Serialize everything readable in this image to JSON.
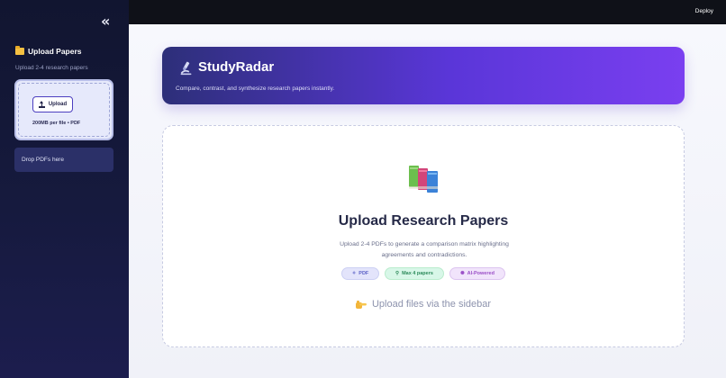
{
  "sidebar": {
    "collapse_icon": "«",
    "title": "Upload Papers",
    "folder_icon": "folder-icon",
    "subtitle": "Upload 2-4 research papers",
    "upload_button": "Upload",
    "limit_text": "200MB per file • PDF",
    "drop_text": "Drop PDFs here"
  },
  "topbar": {
    "deploy_label": "Deploy"
  },
  "hero": {
    "title": "StudyRadar",
    "subtitle": "Compare, contrast, and synthesize research papers instantly.",
    "icon": "microscope-icon"
  },
  "card": {
    "title": "Upload Research Papers",
    "description": "Upload 2-4 PDFs to generate a comparison matrix highlighting agreements and contradictions.",
    "chips": [
      {
        "label": "PDF",
        "icon": "sparkle-icon",
        "color": "#5d62c7"
      },
      {
        "label": "Max 4 papers",
        "icon": "magnifier-icon",
        "color": "#2d8b5b"
      },
      {
        "label": "AI-Powered",
        "icon": "brain-icon",
        "color": "#9b4fc7"
      }
    ],
    "hint": "Upload files via the sidebar",
    "hint_icon": "pointing-hand-icon"
  },
  "colors": {
    "sidebar_bg": "#151938",
    "hero_start": "#2d2f79",
    "hero_end": "#7a3ff0",
    "accent": "#4c3fc0"
  }
}
